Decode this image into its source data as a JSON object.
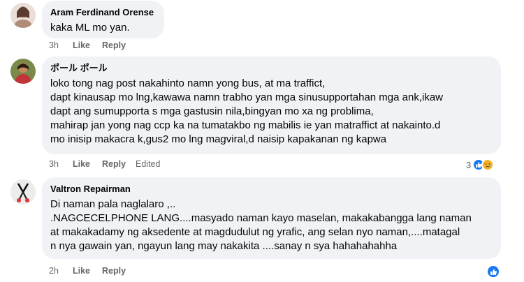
{
  "comments": [
    {
      "author": "Aram Ferdinand Orense",
      "lines": [
        "kaka ML mo yan."
      ],
      "time": "3h",
      "like": "Like",
      "reply": "Reply"
    },
    {
      "author": "ポール ポール",
      "lines": [
        "loko tong nag post nakahinto namn yong bus, at ma traffict,",
        "dapt kinausap mo lng,kawawa namn trabho yan mga sinusupportahan mga ank,ikaw",
        "dapt ang sumupporta s mga gastusin nila,bingyan mo xa ng problima,",
        "mahirap jan yong nag ccp ka na tumatakbo ng mabilis ie yan matraffict at nakainto.d",
        "mo inisip makacra k,gus2 mo lng magviral,d naisip kapakanan ng kapwa"
      ],
      "time": "3h",
      "like": "Like",
      "reply": "Reply",
      "edited": "Edited",
      "reaction_count": "3"
    },
    {
      "author": "Valtron Repairman",
      "lines": [
        "Di naman pala naglalaro ,..",
        ".NAGCECELPHONE LANG....masyado naman kayo maselan, makakabangga lang naman",
        "at makakadamy ng aksedente at magdudulut ng yrafic, ang selan nyo naman,....matagal",
        "n nya gawain yan, ngayun lang may nakakita ....sanay n sya hahahahahha"
      ],
      "time": "2h",
      "like": "Like",
      "reply": "Reply"
    }
  ],
  "colors": {
    "bubble": "#f0f2f5",
    "meta": "#65676b",
    "like_blue": "#1877f2",
    "sad_yellow": "#f7b125"
  }
}
